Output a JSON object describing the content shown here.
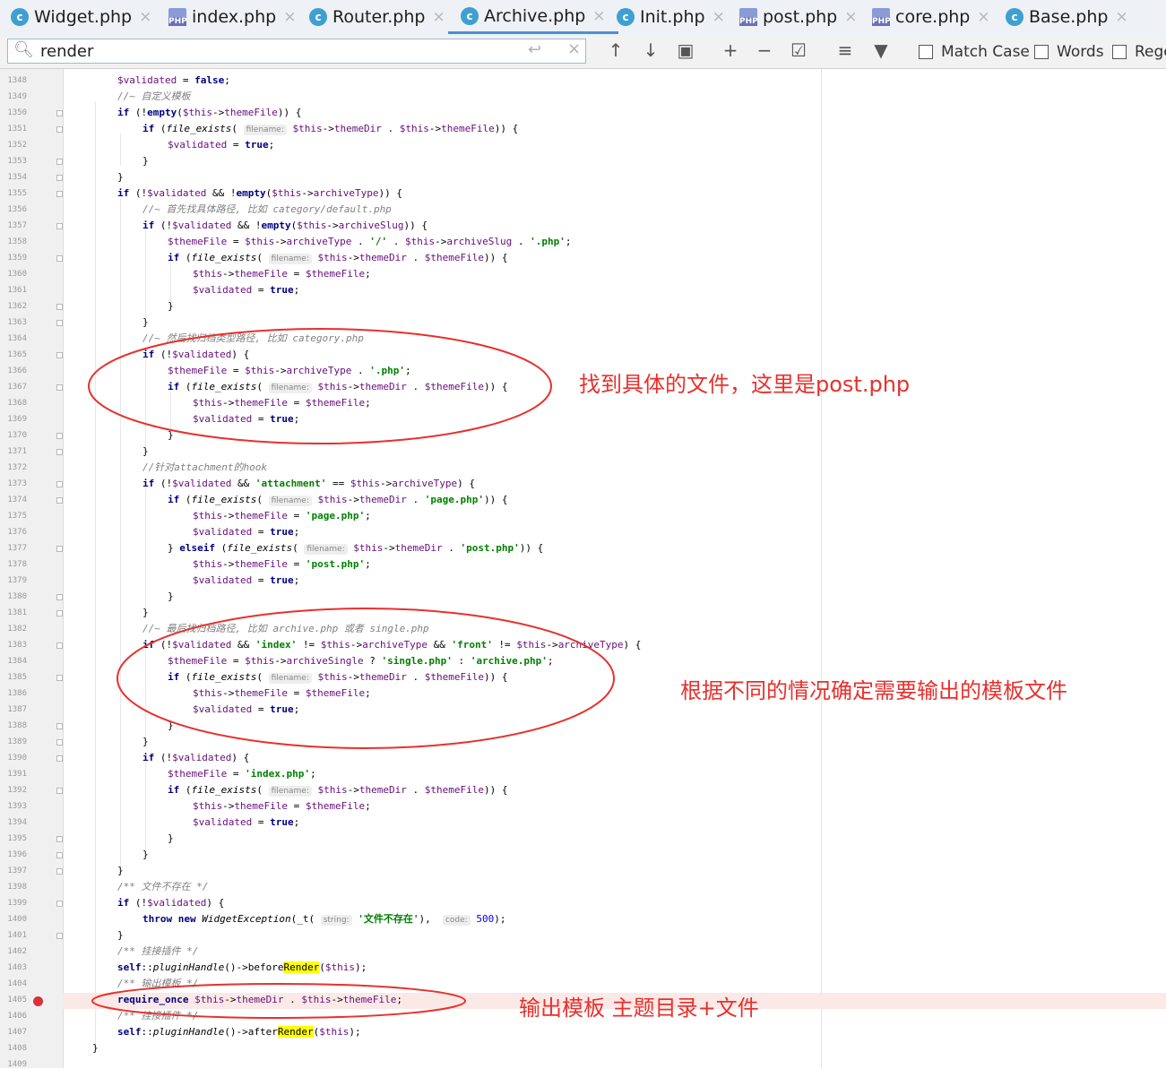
{
  "tabs": [
    {
      "label": "Widget.php",
      "icon": "class-icon"
    },
    {
      "label": "index.php",
      "icon": "php-file-icon"
    },
    {
      "label": "Router.php",
      "icon": "class-icon"
    },
    {
      "label": "Archive.php",
      "icon": "class-icon",
      "active": true
    },
    {
      "label": "Init.php",
      "icon": "class-icon"
    },
    {
      "label": "post.php",
      "icon": "php-file-icon"
    },
    {
      "label": "core.php",
      "icon": "php-file-icon"
    },
    {
      "label": "Base.php",
      "icon": "class-icon"
    }
  ],
  "search": {
    "value": "render",
    "match_case": "Match Case",
    "words": "Words",
    "regex": "Rege"
  },
  "line_numbers": [
    "1348",
    "1349",
    "1350",
    "1351",
    "1352",
    "1353",
    "1354",
    "1355",
    "1356",
    "1357",
    "1358",
    "1359",
    "1360",
    "1361",
    "1362",
    "1363",
    "1364",
    "1365",
    "1366",
    "1367",
    "1368",
    "1369",
    "1370",
    "1371",
    "1372",
    "1373",
    "1374",
    "1375",
    "1376",
    "1377",
    "1378",
    "1379",
    "1380",
    "1381",
    "1382",
    "1383",
    "1384",
    "1385",
    "1386",
    "1387",
    "1388",
    "1389",
    "1390",
    "1391",
    "1392",
    "1393",
    "1394",
    "1395",
    "1396",
    "1397",
    "1398",
    "1399",
    "1400",
    "1401",
    "1402",
    "1403",
    "1404",
    "1405",
    "1406",
    "1407",
    "1408",
    "1409"
  ],
  "param_hints": {
    "filename": "filename:",
    "string": "string:",
    "code": "code:"
  },
  "annotations": {
    "first": "找到具体的文件，这里是post.php",
    "second": "根据不同的情况确定需要输出的模板文件",
    "third": "输出模板 主题目录+文件"
  },
  "colors": {
    "annotation": "#e8302c",
    "breakpoint": "#d9303a",
    "search_highlight": "#ffff00",
    "keyword": "#000080",
    "string": "#008000",
    "variable": "#660e7a"
  }
}
